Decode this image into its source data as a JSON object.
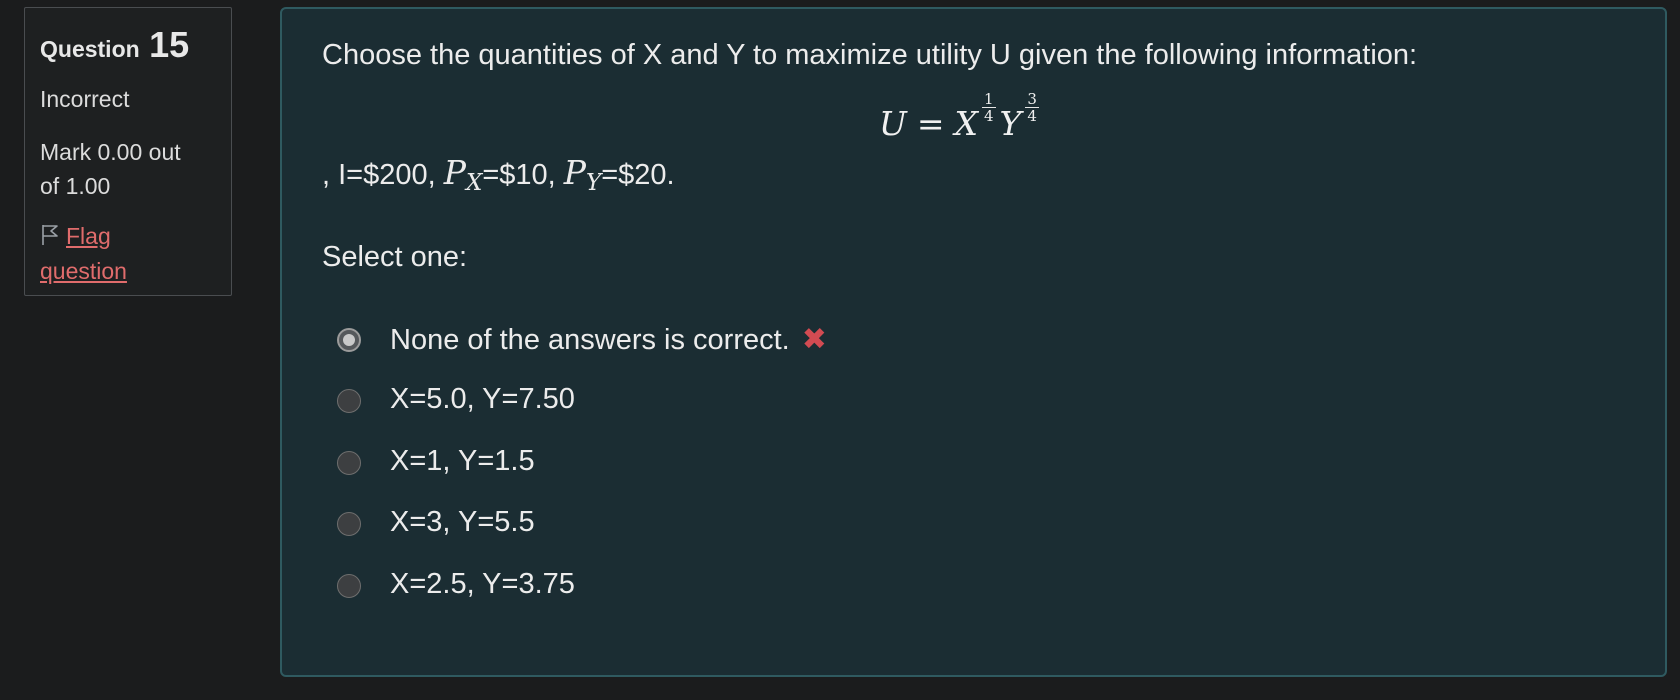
{
  "question_info": {
    "label": "Question",
    "number": "15",
    "state": "Incorrect",
    "grade_line1": "Mark 0.00 out",
    "grade_line2": "of 1.00",
    "flag_line1": "Flag",
    "flag_line2": "question",
    "flag_icon": "flag-outline-icon"
  },
  "question": {
    "text": "Choose the quantities of X and Y to maximize utility U given the following information:",
    "formula": {
      "lhs": "U",
      "equals": "=",
      "base1": "X",
      "exp1_num": "1",
      "exp1_den": "4",
      "base2": "Y",
      "exp2_num": "3",
      "exp2_den": "4"
    },
    "givens": {
      "prefix": ", I=$200, ",
      "px_var": "P",
      "px_sub": "X",
      "px_value": "=$10, ",
      "py_var": "P",
      "py_sub": "Y",
      "py_value": "=$20."
    },
    "prompt": "Select one:"
  },
  "answers": [
    {
      "label": "None of the answers is correct.",
      "selected": true,
      "feedback_icon": "incorrect-cross-icon"
    },
    {
      "label": "X=5.0, Y=7.50",
      "selected": false
    },
    {
      "label": "X=1, Y=1.5",
      "selected": false
    },
    {
      "label": "X=3, Y=5.5",
      "selected": false
    },
    {
      "label": "X=2.5, Y=3.75",
      "selected": false
    }
  ],
  "colors": {
    "page_bg": "#1b1c1d",
    "content_bg": "#1b2d33",
    "content_border": "#2f5a60",
    "flag_link": "#e06c6c",
    "incorrect": "#d24b52"
  }
}
